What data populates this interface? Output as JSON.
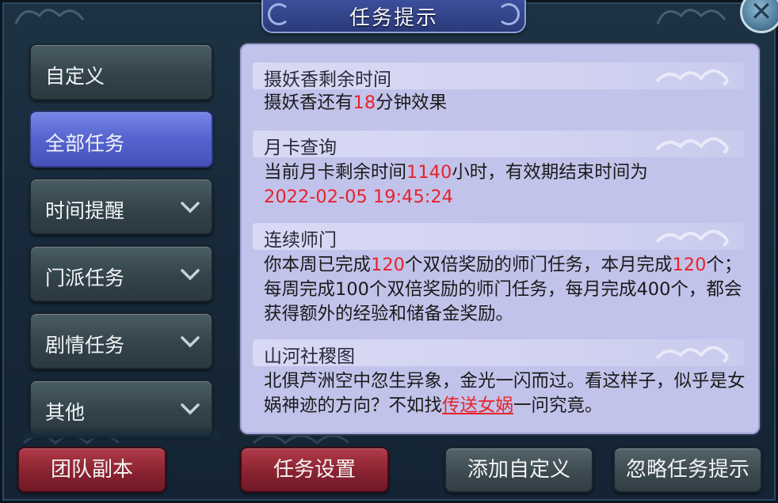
{
  "window": {
    "title": "任务提示",
    "close_label": "✕"
  },
  "sidebar": {
    "items": [
      {
        "label": "自定义",
        "expandable": false
      },
      {
        "label": "全部任务",
        "expandable": false,
        "active": true
      },
      {
        "label": "时间提醒",
        "expandable": true
      },
      {
        "label": "门派任务",
        "expandable": true
      },
      {
        "label": "剧情任务",
        "expandable": true
      },
      {
        "label": "其他",
        "expandable": true
      }
    ]
  },
  "panel": {
    "sections": [
      {
        "title": "摄妖香剩余时间",
        "text": {
          "p1": "摄妖香还有",
          "v1": "18",
          "p2": "分钟效果"
        }
      },
      {
        "title": "月卡查询",
        "text": {
          "p1": "当前月卡剩余时间",
          "v1": "1140",
          "p2": "小时，有效期结束时间为",
          "v2": "2022-02-05 19:45:24"
        }
      },
      {
        "title": "连续师门",
        "text": {
          "p1": "你本周已完成",
          "v1": "120",
          "p2": "个双倍奖励的师门任务，本月完成",
          "v2": "120",
          "p3": "个；每周完成100个双倍奖励的师门任务，每月完成400个，都会获得额外的经验和储备金奖励。"
        }
      },
      {
        "title": "山河社稷图",
        "text": {
          "p1": "北俱芦洲空中忽生异象，金光一闪而过。看这样子，似乎是女娲神迹的方向？不如找",
          "link": "传送女娲",
          "p2": "一问究竟。"
        }
      }
    ]
  },
  "footer": {
    "team_dungeon": "团队副本",
    "task_settings": "任务设置",
    "add_custom": "添加自定义",
    "ignore_tips": "忽略任务提示"
  },
  "colors": {
    "highlight": "#e8232c",
    "panel_bg": "#c2c3ea",
    "active_tab": "#5563d0",
    "red_button": "#8a2331"
  }
}
